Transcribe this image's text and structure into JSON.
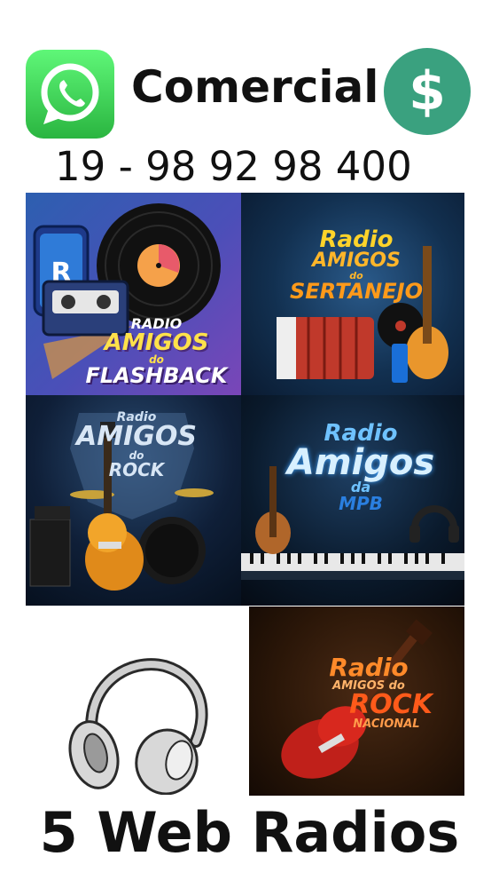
{
  "header": {
    "title": "Comercial",
    "phone": "19 - 98 92 98 400",
    "whatsapp_icon": "whatsapp-icon",
    "dollar_icon": "dollar-icon",
    "dollar_symbol": "$",
    "colors": {
      "whatsapp": "#2ab540",
      "dollar": "#3aa17f"
    }
  },
  "stations": [
    {
      "line1": "RADIO",
      "line2": "AMIGOS",
      "line3": "do",
      "line4": "FLASHBACK",
      "icon": "vinyl-record-icon"
    },
    {
      "line1": "Radio",
      "line2": "AMIGOS",
      "line3": "do",
      "line4": "SERTANEJO",
      "icon": "accordion-icon"
    },
    {
      "line1": "Radio",
      "line2": "AMIGOS",
      "line3": "do",
      "line4": "ROCK",
      "icon": "electric-guitar-icon"
    },
    {
      "line1": "Radio",
      "line2": "Amigos",
      "line3": "da",
      "line4": "MPB",
      "icon": "keyboard-icon"
    },
    {
      "line1": "Radio",
      "line2": "AMIGOS do",
      "line3": "ROCK",
      "line4": "NACIONAL",
      "icon": "red-guitar-icon"
    }
  ],
  "footer": {
    "label": "5 Web Radios",
    "icon": "headphones-icon"
  }
}
